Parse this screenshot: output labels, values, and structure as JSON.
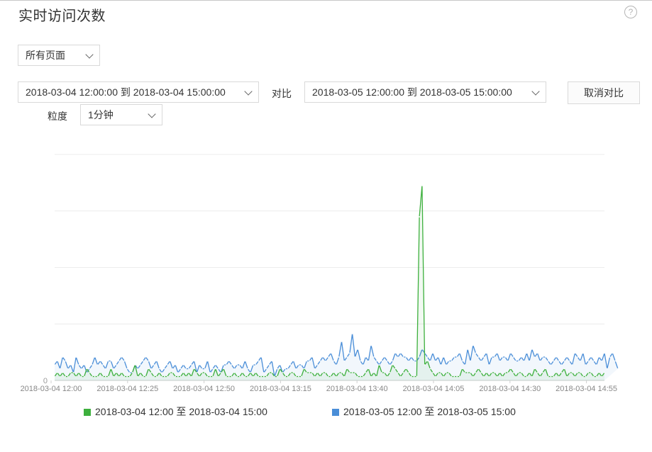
{
  "header": {
    "title": "实时访问次数",
    "help_icon": "?"
  },
  "filters": {
    "page_select": "所有页面",
    "range_primary": "2018-03-04 12:00:00 到 2018-03-04 15:00:00",
    "compare_label": "对比",
    "range_compare": "2018-03-05 12:00:00 到 2018-03-05 15:00:00",
    "cancel_compare": "取消对比",
    "granularity_label": "粒度",
    "granularity_value": "1分钟"
  },
  "colors": {
    "green": "#3db03d",
    "blue": "#4a8ed8",
    "grid": "#ececec",
    "axis": "#999999"
  },
  "chart_data": {
    "type": "line",
    "y_tick_label": "0",
    "x_tick_labels": [
      "2018-03-04 12:00",
      "2018-03-04 12:25",
      "2018-03-04 12:50",
      "2018-03-04 13:15",
      "2018-03-04 13:40",
      "2018-03-04 14:05",
      "2018-03-04 14:30",
      "2018-03-04 14:55"
    ],
    "grid": true,
    "legend_position": "bottom",
    "series": [
      {
        "name": "2018-03-04 12:00 至 2018-03-04 15:00",
        "color": "#3db03d",
        "values": [
          1,
          2,
          1,
          2,
          1,
          1,
          2,
          2,
          1,
          2,
          1,
          1,
          3,
          2,
          1,
          1,
          1,
          2,
          1,
          1,
          1,
          3,
          1,
          2,
          1,
          2,
          1,
          1,
          1,
          2,
          4,
          1,
          2,
          1,
          1,
          3,
          2,
          1,
          1,
          2,
          1,
          1,
          1,
          2,
          2,
          1,
          1,
          1,
          2,
          1,
          2,
          1,
          3,
          2,
          1,
          2,
          2,
          1,
          1,
          1,
          3,
          1,
          2,
          3,
          1,
          1,
          1,
          2,
          1,
          1,
          2,
          1,
          1,
          2,
          1,
          2,
          1,
          1,
          1,
          1,
          2,
          2,
          1,
          1,
          3,
          2,
          1,
          1,
          2,
          2,
          1,
          1,
          1,
          3,
          2,
          2,
          2,
          1,
          2,
          1,
          2,
          2,
          1,
          1,
          2,
          1,
          2,
          2,
          1,
          3,
          2,
          2,
          2,
          1,
          1,
          1,
          2,
          3,
          1,
          2,
          1,
          4,
          2,
          2,
          1,
          2,
          4,
          3,
          2,
          1,
          2,
          3,
          2,
          1,
          1,
          1,
          42,
          50,
          4,
          5,
          3,
          2,
          1,
          2,
          2,
          1,
          2,
          2,
          1,
          1,
          1,
          1,
          3,
          2,
          2,
          2,
          1,
          2,
          3,
          2,
          1,
          2,
          1,
          2,
          2,
          1,
          2,
          1,
          2,
          2,
          3,
          2,
          1,
          2,
          2,
          1,
          1,
          2,
          1,
          3,
          2,
          1,
          2,
          3,
          1,
          1,
          1,
          2,
          1,
          2,
          3,
          1,
          2,
          2,
          1,
          2,
          2,
          1,
          1,
          2,
          2,
          1,
          1,
          2,
          1,
          2
        ]
      },
      {
        "name": "2018-03-05 12:00 至 2018-03-05 15:00",
        "color": "#4a8ed8",
        "values": [
          4,
          5,
          3,
          6,
          5,
          3,
          4,
          2,
          6,
          4,
          3,
          4,
          2,
          3,
          4,
          6,
          4,
          5,
          4,
          3,
          5,
          5,
          3,
          4,
          5,
          6,
          5,
          3,
          2,
          2,
          4,
          3,
          4,
          5,
          6,
          5,
          3,
          4,
          5,
          3,
          2,
          3,
          4,
          5,
          3,
          4,
          2,
          3,
          4,
          3,
          3,
          4,
          5,
          2,
          4,
          3,
          3,
          5,
          2,
          3,
          4,
          3,
          2,
          4,
          4,
          5,
          4,
          3,
          4,
          4,
          3,
          5,
          3,
          2,
          4,
          4,
          5,
          6,
          2,
          3,
          4,
          5,
          1,
          3,
          4,
          2,
          3,
          3,
          4,
          5,
          3,
          4,
          4,
          3,
          5,
          5,
          6,
          3,
          4,
          5,
          6,
          5,
          6,
          7,
          5,
          4,
          6,
          10,
          5,
          6,
          7,
          12,
          6,
          8,
          5,
          4,
          6,
          5,
          9,
          6,
          5,
          4,
          5,
          6,
          5,
          4,
          5,
          7,
          6,
          7,
          6,
          6,
          5,
          6,
          5,
          5,
          6,
          8,
          7,
          6,
          5,
          7,
          5,
          6,
          4,
          6,
          4,
          5,
          5,
          6,
          6,
          7,
          5,
          4,
          8,
          5,
          9,
          7,
          6,
          5,
          6,
          7,
          4,
          6,
          6,
          7,
          5,
          6,
          6,
          5,
          7,
          6,
          5,
          5,
          6,
          5,
          7,
          5,
          8,
          6,
          7,
          5,
          6,
          6,
          5,
          4,
          5,
          6,
          5,
          4,
          5,
          6,
          5,
          4,
          7,
          6,
          5,
          7,
          4,
          5,
          6,
          5,
          4,
          6,
          5,
          7,
          3,
          6,
          7,
          5,
          3
        ]
      }
    ]
  }
}
